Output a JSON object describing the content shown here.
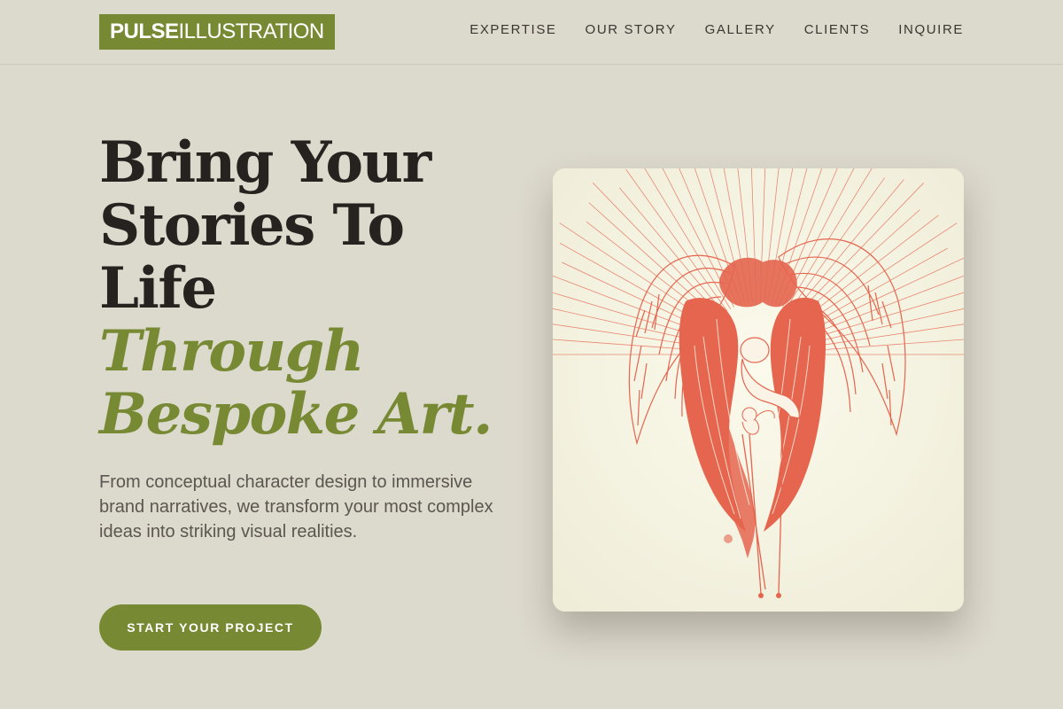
{
  "brand": {
    "name_strong": "PULSE",
    "name_light": "ILLUSTRATION"
  },
  "nav": {
    "items": [
      {
        "label": "EXPERTISE"
      },
      {
        "label": "OUR STORY"
      },
      {
        "label": "GALLERY"
      },
      {
        "label": "CLIENTS"
      },
      {
        "label": "INQUIRE"
      }
    ]
  },
  "hero": {
    "title_lines": [
      "Bring Your",
      "Stories To",
      "Life"
    ],
    "accent_lines": [
      "Through",
      "Bespoke Art."
    ],
    "description": "From conceptual character design to immersive brand narratives, we transform your most complex ideas into striking visual realities.",
    "cta_label": "START YOUR PROJECT"
  },
  "artwork": {
    "icon": "angel-illustration",
    "colors": {
      "ink": "#e5654f",
      "paper": "#f8f6e4"
    }
  },
  "colors": {
    "background": "#dcd9cd",
    "accent": "#778a33",
    "heading": "#252220",
    "body_text": "#5a5650"
  }
}
